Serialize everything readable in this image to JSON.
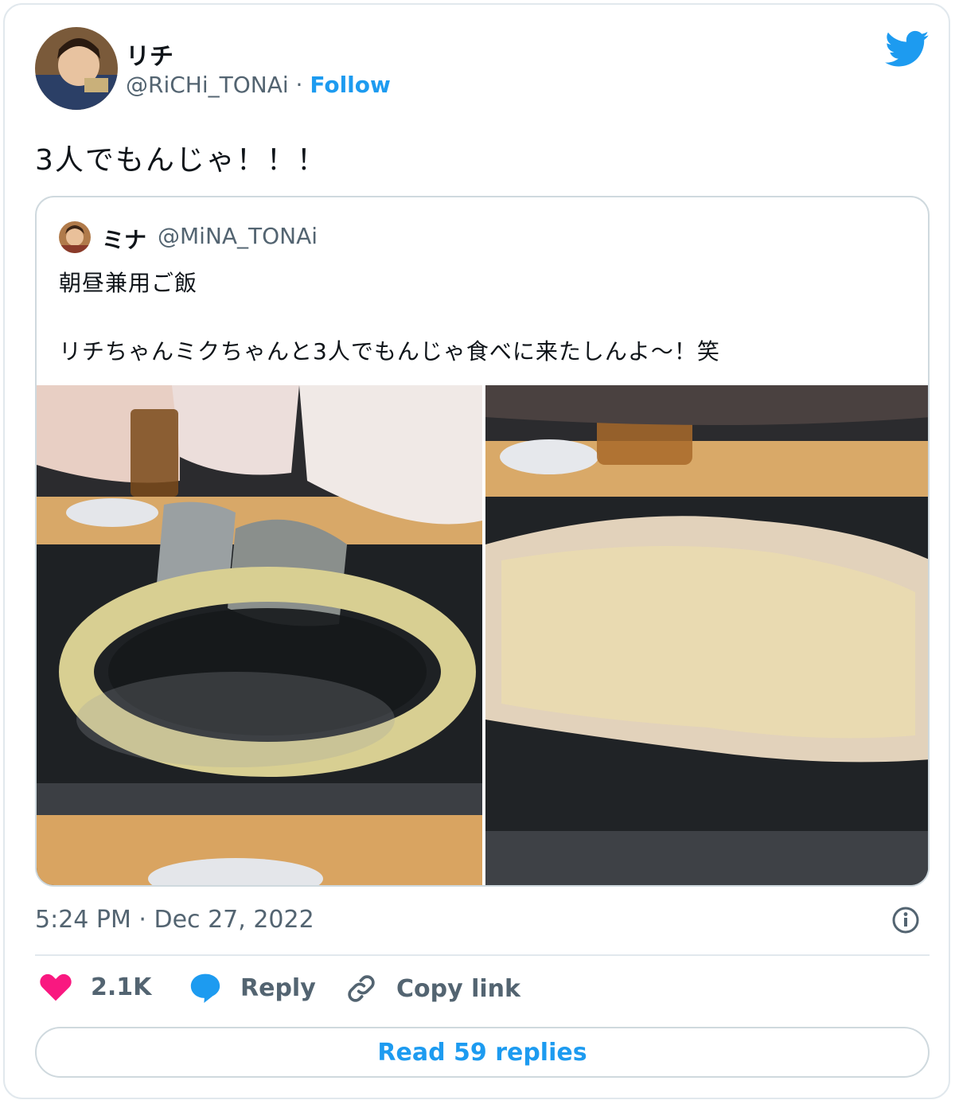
{
  "author": {
    "name": "リチ",
    "handle": "@RiCHi_TONAi",
    "separator": "·",
    "follow_label": "Follow"
  },
  "tweet": {
    "text": "3人でもんじゃ！！！"
  },
  "quoted": {
    "name": "ミナ",
    "handle": "@MiNA_TONAi",
    "text_line1": "朝昼兼用ご飯",
    "text_line2": "リチちゃんミクちゃんと3人でもんじゃ食べに来たしんよ〜！笑"
  },
  "timestamp": "5:24 PM · Dec 27, 2022",
  "actions": {
    "likes": "2.1K",
    "reply_label": "Reply",
    "copy_label": "Copy link"
  },
  "read_replies_label": "Read 59 replies",
  "colors": {
    "accent": "#1d9bf0",
    "like": "#f91880",
    "secondary_text": "#536471"
  }
}
